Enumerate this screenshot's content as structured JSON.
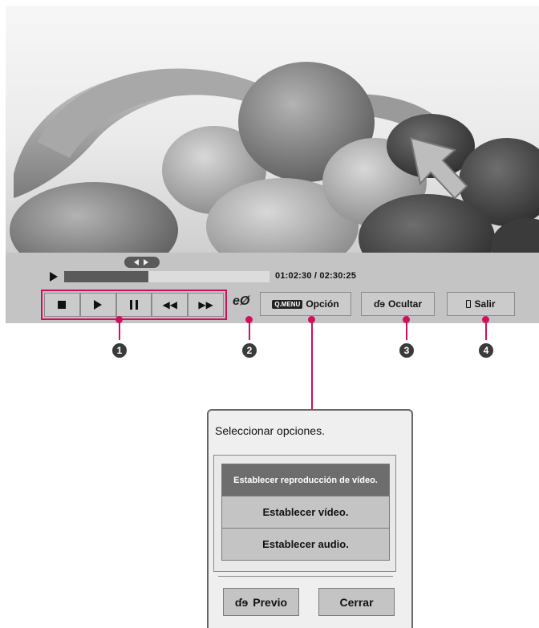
{
  "player": {
    "time_display": "01:02:30 / 02:30:25",
    "progress_fraction": 0.41,
    "controls": [
      {
        "name": "stop-button",
        "icon": "stop-icon"
      },
      {
        "name": "play-button",
        "icon": "play-icon"
      },
      {
        "name": "pause-button",
        "icon": "pause-icon"
      },
      {
        "name": "rewind-button",
        "icon": "rewind-icon",
        "glyph": "◀◀"
      },
      {
        "name": "fast-forward-button",
        "icon": "fast-forward-icon",
        "glyph": "▶▶"
      }
    ],
    "eco_label": "eØ",
    "option_key": "Q.MENU",
    "option_label": "Opción",
    "hide_icon": "ɗɘ",
    "hide_label": "Ocultar",
    "exit_label": "Salir"
  },
  "callouts": [
    "1",
    "2",
    "3",
    "4"
  ],
  "dialog": {
    "title": "Seleccionar opciones.",
    "options": [
      "Establecer reproducción de vídeo.",
      "Establecer vídeo.",
      "Establecer audio."
    ],
    "prev_icon": "ɗɘ",
    "prev_label": "Previo",
    "close_label": "Cerrar"
  },
  "colors": {
    "accent": "#d0105e",
    "bar": "#c4c4c4",
    "selected_option": "#6d6d6d"
  }
}
